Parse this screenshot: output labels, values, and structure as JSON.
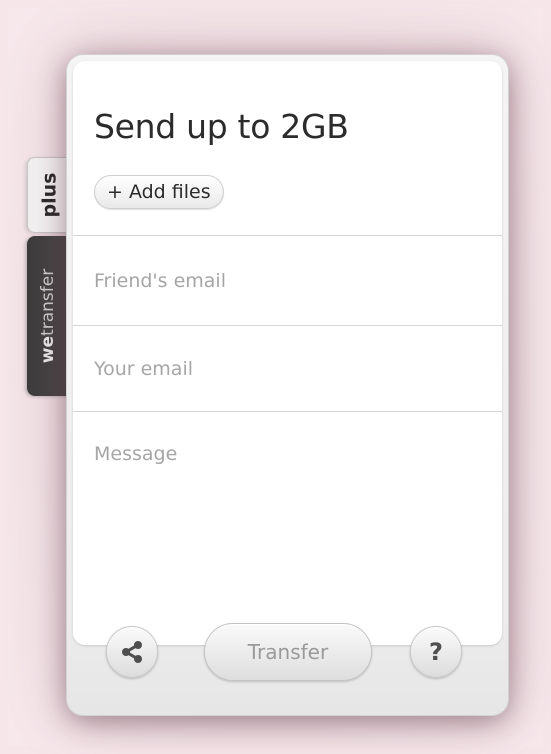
{
  "tabs": {
    "plus_label": "plus",
    "brand_prefix": "we",
    "brand_suffix": "transfer"
  },
  "panel": {
    "title": "Send up to 2GB",
    "add_files_label": "+ Add files",
    "friend_email_placeholder": "Friend's email",
    "your_email_placeholder": "Your email",
    "message_placeholder": "Message"
  },
  "footer": {
    "share_icon": "share-icon",
    "transfer_label": "Transfer",
    "help_label": "?"
  },
  "colors": {
    "background": "#f6e6ea",
    "tab_dark": "#3b3b3b",
    "text_dark": "#2b2b2b",
    "placeholder": "#a6a6a6"
  }
}
